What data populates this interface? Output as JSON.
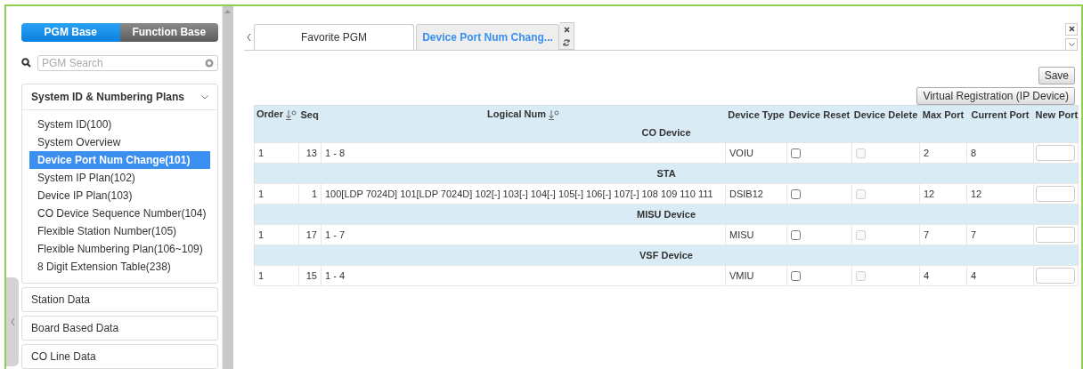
{
  "sidebar": {
    "modes": [
      {
        "label": "PGM Base",
        "selected": true
      },
      {
        "label": "Function Base",
        "selected": false
      }
    ],
    "search": {
      "placeholder": "PGM Search"
    },
    "sections": [
      {
        "title": "System ID & Numbering Plans",
        "expanded": true,
        "items": [
          {
            "label": "System ID(100)",
            "selected": false
          },
          {
            "label": "System Overview",
            "selected": false
          },
          {
            "label": "Device Port Num Change(101)",
            "selected": true
          },
          {
            "label": "System IP Plan(102)",
            "selected": false
          },
          {
            "label": "Device IP Plan(103)",
            "selected": false
          },
          {
            "label": "CO Device Sequence Number(104)",
            "selected": false
          },
          {
            "label": "Flexible Station Number(105)",
            "selected": false
          },
          {
            "label": "Flexible Numbering Plan(106~109)",
            "selected": false
          },
          {
            "label": "8 Digit Extension Table(238)",
            "selected": false
          }
        ]
      },
      {
        "title": "Station Data",
        "expanded": false
      },
      {
        "title": "Board Based Data",
        "expanded": false
      },
      {
        "title": "CO Line Data",
        "expanded": false
      }
    ]
  },
  "tabs": [
    {
      "label": "Favorite PGM",
      "selected": false
    },
    {
      "label": "Device Port Num Chang...",
      "selected": true
    }
  ],
  "buttons": {
    "save": "Save",
    "virtual": "Virtual Registration (IP Device)"
  },
  "table": {
    "columns": [
      {
        "label": "Order",
        "sortable": true
      },
      {
        "label": "Seq",
        "sortable": false
      },
      {
        "label": "Logical Num",
        "sortable": true
      },
      {
        "label": "Device Type",
        "sortable": false
      },
      {
        "label": "Device Reset",
        "sortable": false
      },
      {
        "label": "Device Delete",
        "sortable": false
      },
      {
        "label": "Max Port",
        "sortable": false
      },
      {
        "label": "Current Port",
        "sortable": false
      },
      {
        "label": "New Port",
        "sortable": false
      }
    ],
    "groups": [
      {
        "title": "CO Device",
        "rows": [
          {
            "order": "1",
            "seq": "13",
            "logical_num": "1 - 8",
            "device_type": "VOIU",
            "reset": {
              "checked": false,
              "disabled": false
            },
            "delete": {
              "checked": false,
              "disabled": true
            },
            "max_port": "2",
            "current_port": "8"
          }
        ]
      },
      {
        "title": "STA",
        "rows": [
          {
            "order": "1",
            "seq": "1",
            "logical_num": "100[LDP 7024D] 101[LDP 7024D] 102[-] 103[-] 104[-] 105[-] 106[-] 107[-] 108 109 110 111",
            "device_type": "DSIB12",
            "reset": {
              "checked": false,
              "disabled": false
            },
            "delete": {
              "checked": false,
              "disabled": true
            },
            "max_port": "12",
            "current_port": "12"
          }
        ]
      },
      {
        "title": "MISU Device",
        "rows": [
          {
            "order": "1",
            "seq": "17",
            "logical_num": "1 - 7",
            "device_type": "MISU",
            "reset": {
              "checked": false,
              "disabled": false
            },
            "delete": {
              "checked": false,
              "disabled": true
            },
            "max_port": "7",
            "current_port": "7"
          }
        ]
      },
      {
        "title": "VSF Device",
        "rows": [
          {
            "order": "1",
            "seq": "15",
            "logical_num": "1 - 4",
            "device_type": "VMIU",
            "reset": {
              "checked": false,
              "disabled": false
            },
            "delete": {
              "checked": false,
              "disabled": true
            },
            "max_port": "4",
            "current_port": "4"
          }
        ]
      }
    ]
  }
}
